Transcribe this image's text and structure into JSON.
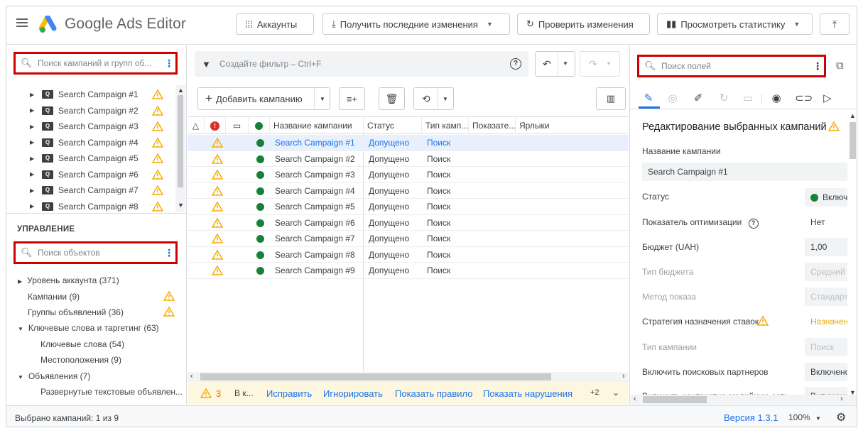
{
  "app": {
    "brand": "Google Ads Editor"
  },
  "toolbar": {
    "accounts": "Аккаунты",
    "get_changes": "Получить последние изменения",
    "check_changes": "Проверить изменения",
    "view_stats": "Просмотреть статистику"
  },
  "left": {
    "campaign_search_placeholder": "Поиск кампаний и групп об...",
    "campaigns": [
      "Search Campaign #1",
      "Search Campaign #2",
      "Search Campaign #3",
      "Search Campaign #4",
      "Search Campaign #5",
      "Search Campaign #6",
      "Search Campaign #7",
      "Search Campaign #8"
    ],
    "management_title": "УПРАВЛЕНИЕ",
    "object_search_placeholder": "Поиск объектов",
    "management_items": [
      {
        "label": "Уровень аккаунта (371)"
      },
      {
        "label": "Кампании (9)"
      },
      {
        "label": "Группы объявлений (36)"
      },
      {
        "label": "Ключевые слова и таргетинг (63)"
      },
      {
        "label": "Ключевые слова (54)"
      },
      {
        "label": "Местоположения (9)"
      },
      {
        "label": "Объявления (7)"
      },
      {
        "label": "Развернутые текстовые объявлен..."
      }
    ]
  },
  "center": {
    "filter_placeholder": "Создайте фильтр – Ctrl+F",
    "add_campaign": "Добавить кампанию",
    "columns": {
      "name": "Название кампании",
      "status": "Статус",
      "type": "Тип камп...",
      "indicator": "Показате...",
      "labels": "Ярлыки"
    },
    "rows": [
      {
        "name": "Search Campaign #1",
        "status": "Допущено",
        "type": "Поиск"
      },
      {
        "name": "Search Campaign #2",
        "status": "Допущено",
        "type": "Поиск"
      },
      {
        "name": "Search Campaign #3",
        "status": "Допущено",
        "type": "Поиск"
      },
      {
        "name": "Search Campaign #4",
        "status": "Допущено",
        "type": "Поиск"
      },
      {
        "name": "Search Campaign #5",
        "status": "Допущено",
        "type": "Поиск"
      },
      {
        "name": "Search Campaign #6",
        "status": "Допущено",
        "type": "Поиск"
      },
      {
        "name": "Search Campaign #7",
        "status": "Допущено",
        "type": "Поиск"
      },
      {
        "name": "Search Campaign #8",
        "status": "Допущено",
        "type": "Поиск"
      },
      {
        "name": "Search Campaign #9",
        "status": "Допущено",
        "type": "Поиск"
      }
    ],
    "issues": {
      "count": "3",
      "text": "В к...",
      "fix": "Исправить",
      "ignore": "Игнорировать",
      "show_rule": "Показать правило",
      "show_violations": "Показать нарушения",
      "more": "+2"
    }
  },
  "right": {
    "field_search_placeholder": "Поиск полей",
    "title": "Редактирование выбранных кампаний",
    "fields": {
      "name_label": "Название кампании",
      "name_value": "Search Campaign #1",
      "status_label": "Статус",
      "status_value": "Включ",
      "opt_label": "Показатель оптимизации",
      "opt_value": "Нет",
      "budget_label": "Бюджет (UAH)",
      "budget_value": "1,00",
      "budget_type_label": "Тип бюджета",
      "budget_type_value": "Средний д",
      "delivery_label": "Метод показа",
      "delivery_value": "Стандартн",
      "bidding_label": "Стратегия назначения ставок",
      "bidding_value": "Назначен...",
      "camp_type_label": "Тип кампании",
      "camp_type_value": "Поиск",
      "partners_label": "Включить поисковых партнеров",
      "partners_value": "Включено",
      "display_label": "Включить контекстно-медийную сеть",
      "display_value": "Включено"
    }
  },
  "bottom": {
    "selected": "Выбрано кампаний: 1 из 9",
    "version": "Версия 1.3.1",
    "zoom": "100%"
  },
  "colors": {
    "accent": "#1a73e8",
    "highlight": "#d00000",
    "warning": "#f9ab00",
    "ok": "#188038"
  }
}
